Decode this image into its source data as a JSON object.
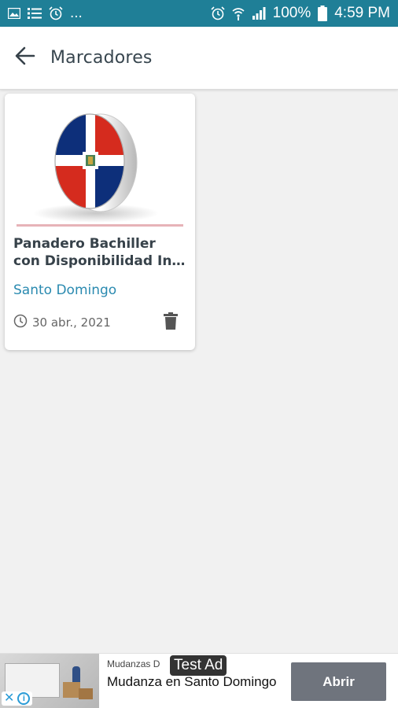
{
  "status_bar": {
    "left_icons": [
      "image-icon",
      "list-icon",
      "alarm-icon",
      "more-dots-icon"
    ],
    "more_dots": "...",
    "right_icons": [
      "alarm-icon",
      "wifi-icon",
      "signal-icon",
      "battery-icon"
    ],
    "battery": "100%",
    "time": "4:59 PM"
  },
  "app_bar": {
    "back_icon": "arrow-left-icon",
    "title": "Marcadores"
  },
  "bookmarks": [
    {
      "image": "dominican-flag-badge",
      "title_line1": "Panadero Bachiller",
      "title_line2": "con Disponibilidad Inm...",
      "location": "Santo Domingo",
      "date": "30 abr., 2021",
      "date_icon": "clock-icon",
      "delete_icon": "trash-icon"
    }
  ],
  "ad": {
    "advertiser": "Mudanzas D",
    "badge": "Test Ad",
    "headline": "Mudanza en Santo Domingo",
    "cta": "Abrir",
    "close_icon": "close-icon",
    "info_icon": "info-icon",
    "info_glyph": "i",
    "close_glyph": "✕"
  },
  "colors": {
    "status_bar": "#1f7f97",
    "location_link": "#2a8ab0",
    "cta_button": "#6f747d"
  }
}
